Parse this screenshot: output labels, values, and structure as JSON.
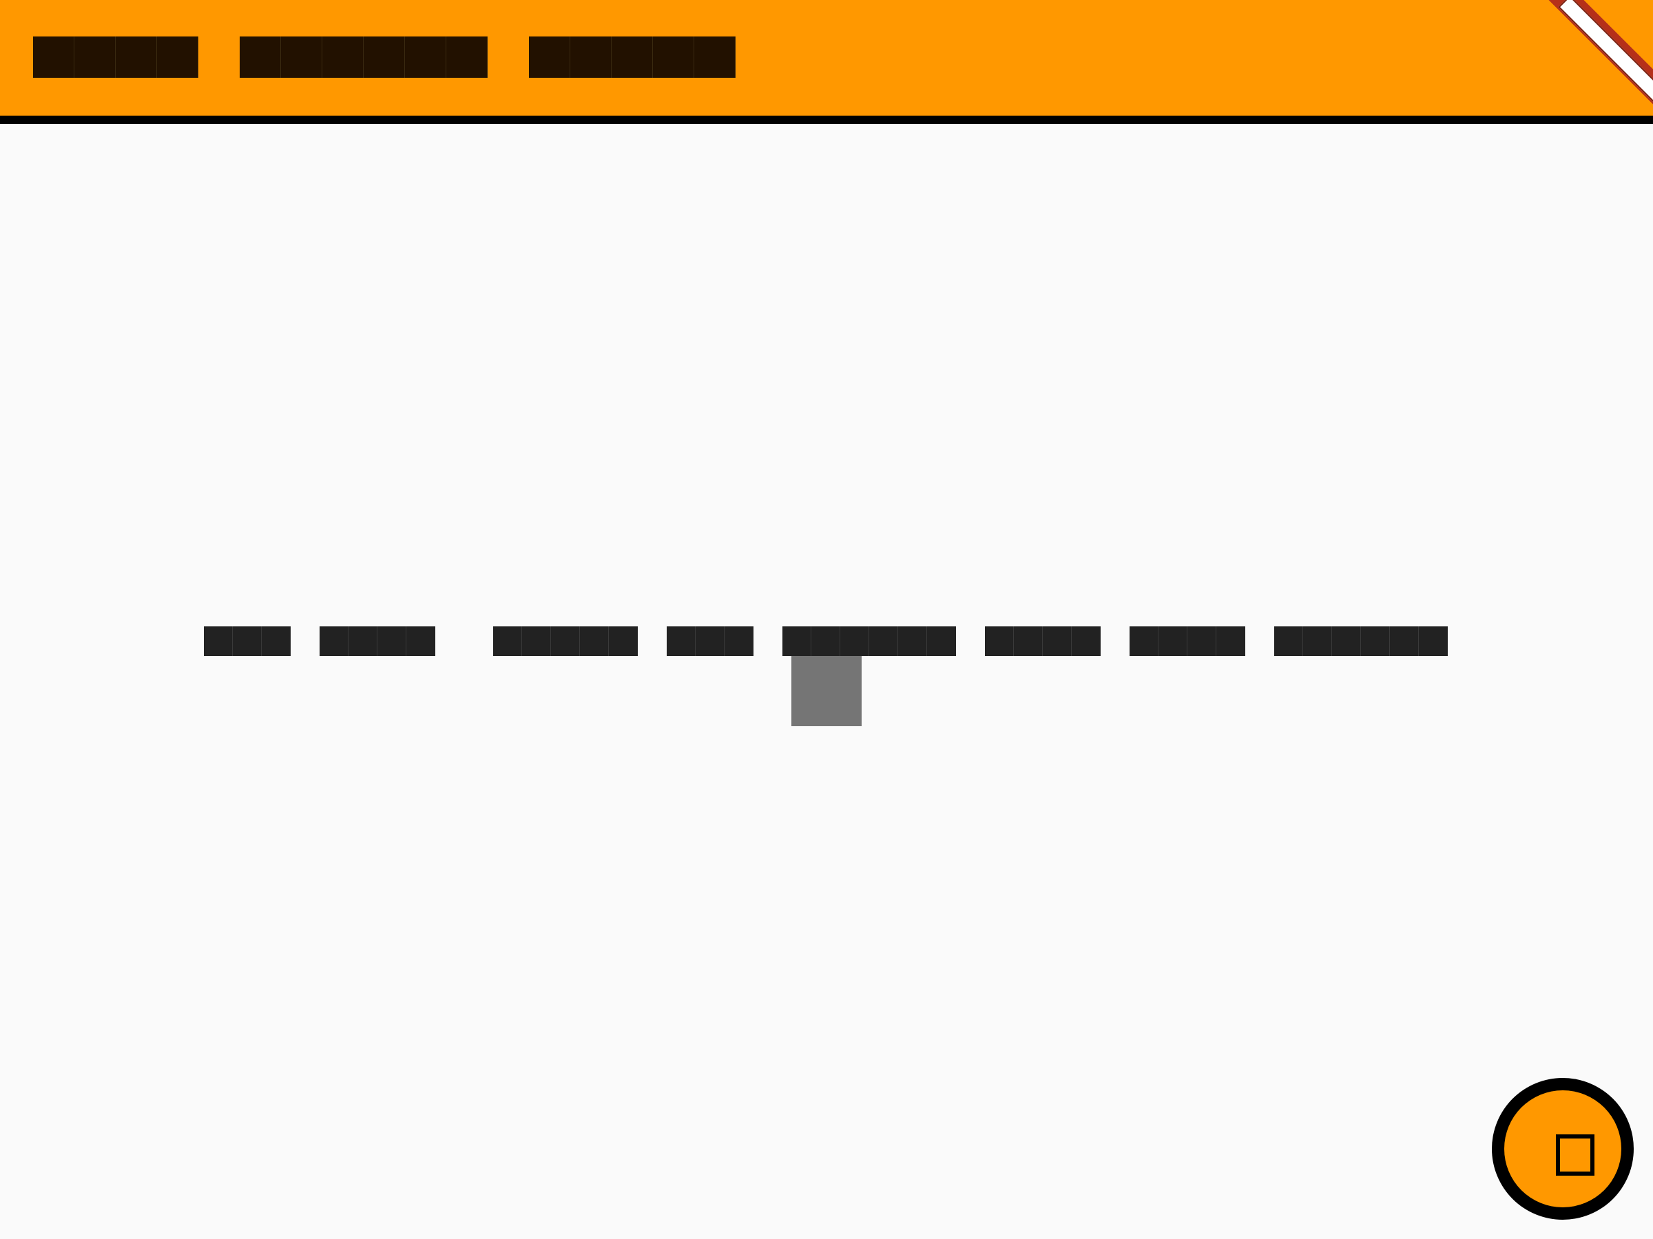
{
  "header": {
    "tabs": [
      {
        "label": "",
        "glyph_count": 4
      },
      {
        "label": "",
        "glyph_count": 6
      },
      {
        "label": "",
        "glyph_count": 5
      }
    ],
    "ribbon_label": ""
  },
  "main": {
    "message": "",
    "words": [
      3,
      4,
      5,
      3,
      6,
      4,
      4,
      6
    ]
  },
  "fab": {
    "icon": "stop-square-icon"
  },
  "colors": {
    "accent": "#ff9800",
    "text_dark": "#221100",
    "background": "#fafafa",
    "ribbon": "#b5301a"
  }
}
